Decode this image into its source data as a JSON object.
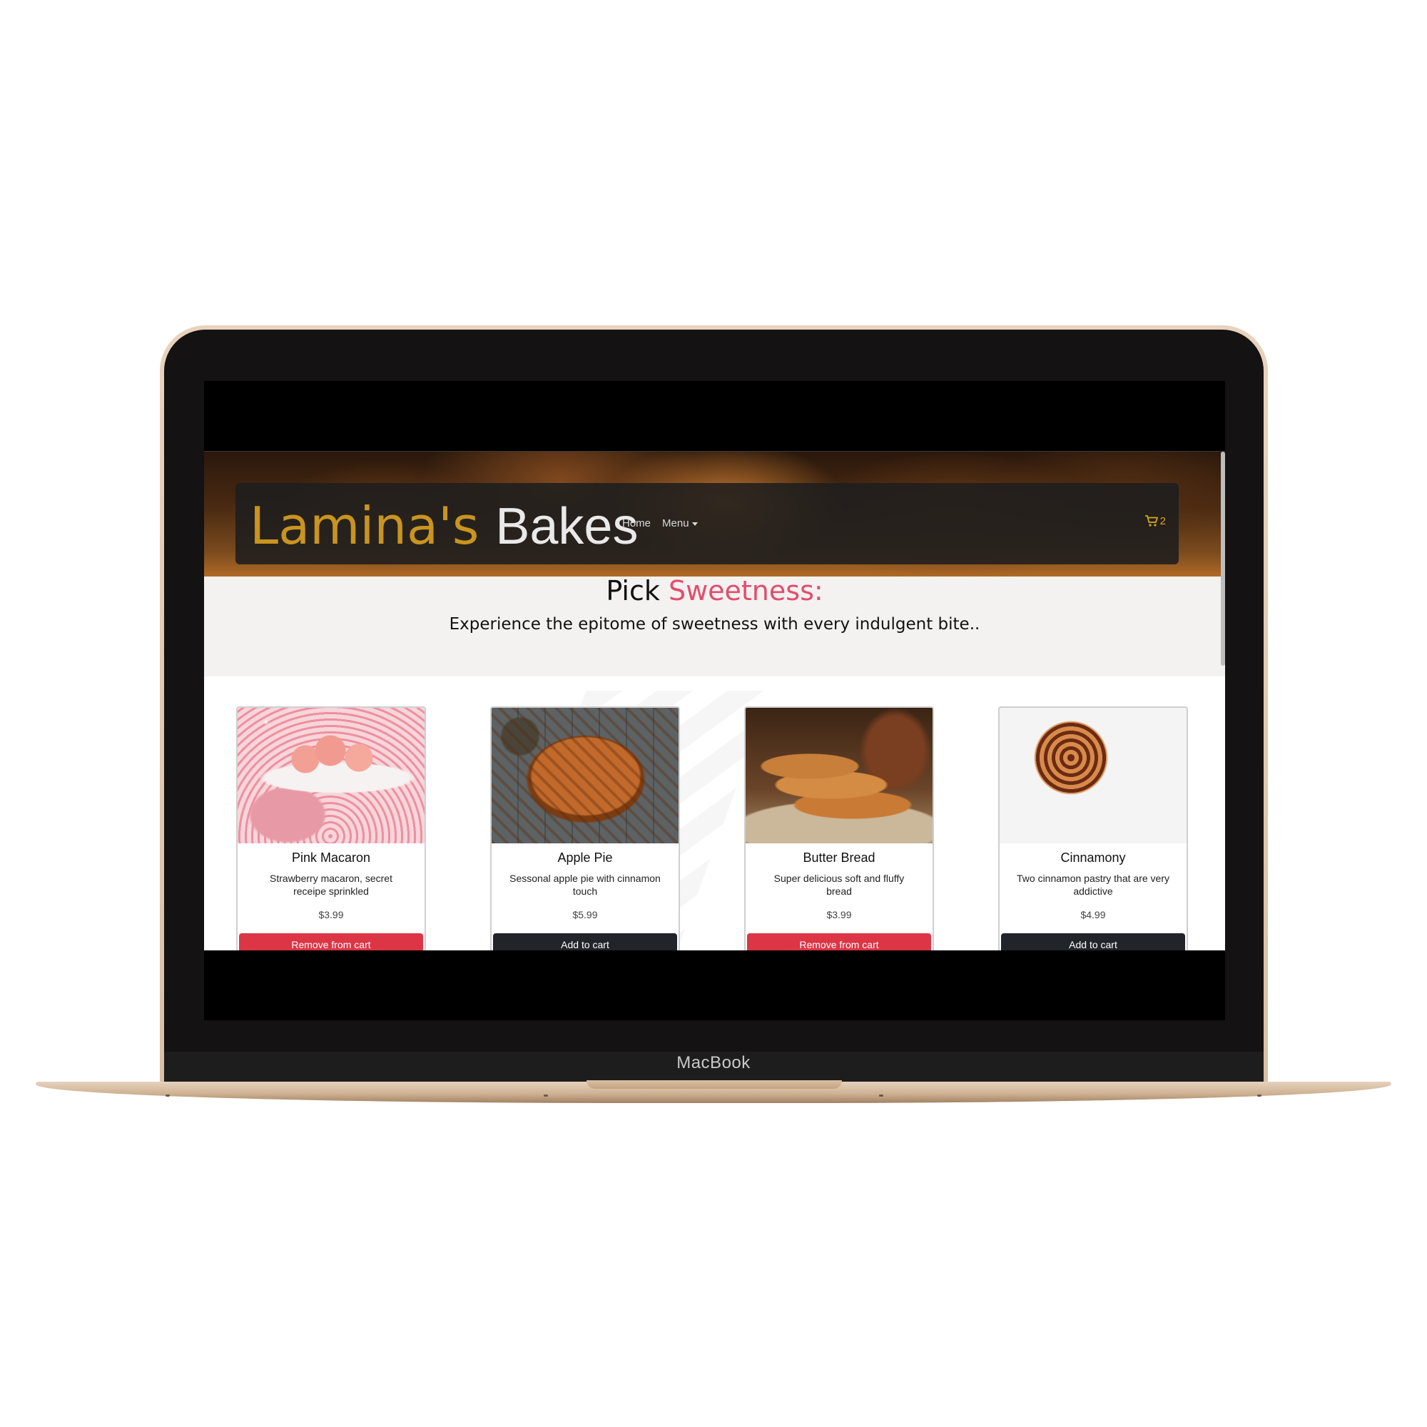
{
  "device": {
    "label": "MacBook"
  },
  "navbar": {
    "brand_first": "Lamina's",
    "brand_second": "Bakes",
    "links": [
      "Home",
      "Menu"
    ],
    "cart_count": "2",
    "cart_icon": "cart-icon"
  },
  "intro": {
    "title_plain": "Pick",
    "title_accent": "Sweetness:",
    "subtitle": "Experience the epitome of sweetness with every indulgent bite.."
  },
  "products": [
    {
      "title": "Pink Macaron",
      "description": "Strawberry macaron, secret receipe sprinkled",
      "price": "$3.99",
      "button": "Remove from cart",
      "in_cart": true
    },
    {
      "title": "Apple Pie",
      "description": "Sessonal apple pie with cinnamon touch",
      "price": "$5.99",
      "button": "Add to cart",
      "in_cart": false
    },
    {
      "title": "Butter Bread",
      "description": "Super delicious soft and fluffy bread",
      "price": "$3.99",
      "button": "Remove from cart",
      "in_cart": true
    },
    {
      "title": "Cinnamony",
      "description": "Two cinnamon pastry that are very addictive",
      "price": "$4.99",
      "button": "Add to cart",
      "in_cart": false
    }
  ],
  "colors": {
    "brand_gold": "#c9941f",
    "accent_pink": "#e34d6b",
    "remove_button": "#dc3545",
    "add_button": "#212529",
    "cart_gold": "#d7a91e"
  }
}
